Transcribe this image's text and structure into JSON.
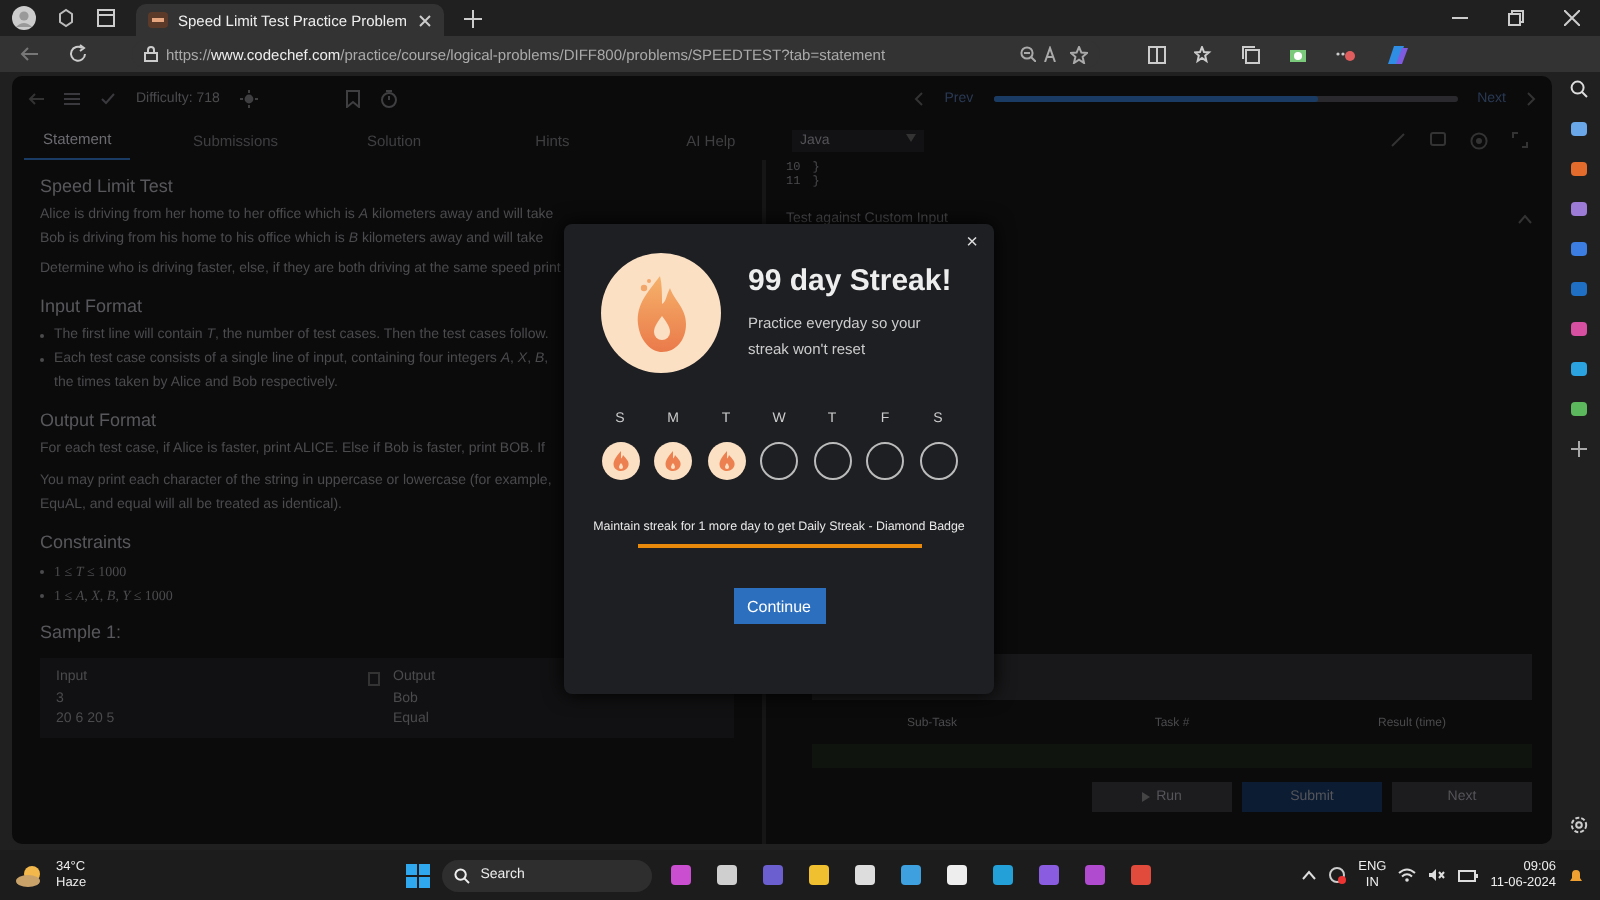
{
  "browser": {
    "tab_title": "Speed Limit Test Practice Problem",
    "url_domain": "www.codechef.com",
    "url_prefix": "https://",
    "url_path": "/practice/course/logical-problems/DIFF800/problems/SPEEDTEST?tab=statement"
  },
  "toolbar": {
    "difficulty": "Difficulty: 718",
    "prev": "Prev",
    "next": "Next",
    "progress": {
      "level": 0.7
    }
  },
  "tabs": [
    {
      "label": "Statement",
      "selected": true
    },
    {
      "label": "Submissions",
      "selected": false
    },
    {
      "label": "Solution",
      "selected": false
    },
    {
      "label": "Hints",
      "selected": false
    },
    {
      "label": "AI Help",
      "selected": false
    }
  ],
  "problem": {
    "title": "Speed Limit Test",
    "intro": [
      "Alice is driving from her home to her office which is *A* kilometers away and will take",
      "Bob is driving from his home to his office which is *B* kilometers away and will take"
    ],
    "task": "Determine who is driving faster, else, if they are both driving at the same speed print",
    "input_heading": "Input Format",
    "input_items": [
      "The first line will contain *T*, the number of test cases. Then the test cases follow.",
      "Each test case consists of a single line of input, containing four integers *A*, *X*, *B*,"
    ],
    "input_continuation": "the times taken by Alice and Bob respectively.",
    "output_heading": "Output Format",
    "output_lines": [
      "For each test case, if Alice is faster, print ALICE. Else if Bob is faster, print BOB. If",
      "You may print each character of the string in uppercase or lowercase (for example,",
      "EquAL, and equal will all be treated as identical)."
    ],
    "constraints_heading": "Constraints",
    "constraints": [
      "1 ≤ *T* ≤ 1000",
      "1 ≤ *A*, *X*, *B*, *Y* ≤ 1000"
    ],
    "sample_heading": "Sample 1:",
    "sample_input": {
      "label": "Input",
      "lines": [
        "3",
        "20 6 20 5"
      ]
    },
    "sample_output": {
      "label": "Output",
      "lines": [
        "Bob",
        "Equal"
      ]
    }
  },
  "editor": {
    "language": "Java",
    "code_lines": [
      {
        "number": "10",
        "code": "}"
      },
      {
        "number": "11",
        "code": "}"
      }
    ],
    "custom_input": "Test against Custom Input",
    "result_columns": [
      "Sub-Task",
      "Task #",
      "Result (time)"
    ],
    "buttons": [
      {
        "label": "Run",
        "kind": "run"
      },
      {
        "label": "Submit",
        "kind": "submit"
      },
      {
        "label": "Next",
        "kind": "next"
      }
    ]
  },
  "modal": {
    "title": "99 day Streak!",
    "message": "Practice everyday so your streak won't reset",
    "days": [
      {
        "letter": "S",
        "done": true
      },
      {
        "letter": "M",
        "done": true
      },
      {
        "letter": "T",
        "done": true
      },
      {
        "letter": "W",
        "done": false
      },
      {
        "letter": "T",
        "done": false
      },
      {
        "letter": "F",
        "done": false
      },
      {
        "letter": "S",
        "done": false
      }
    ],
    "milestone": "Maintain streak for 1 more day to get Daily Streak - Diamond Badge",
    "button": "Continue",
    "close": "×"
  },
  "taskbar": {
    "temperature": "34°C",
    "weather": "Haze",
    "search_placeholder": "Search",
    "language": "ENG",
    "region": "IN",
    "time": "09:06",
    "date": "11-06-2024"
  }
}
